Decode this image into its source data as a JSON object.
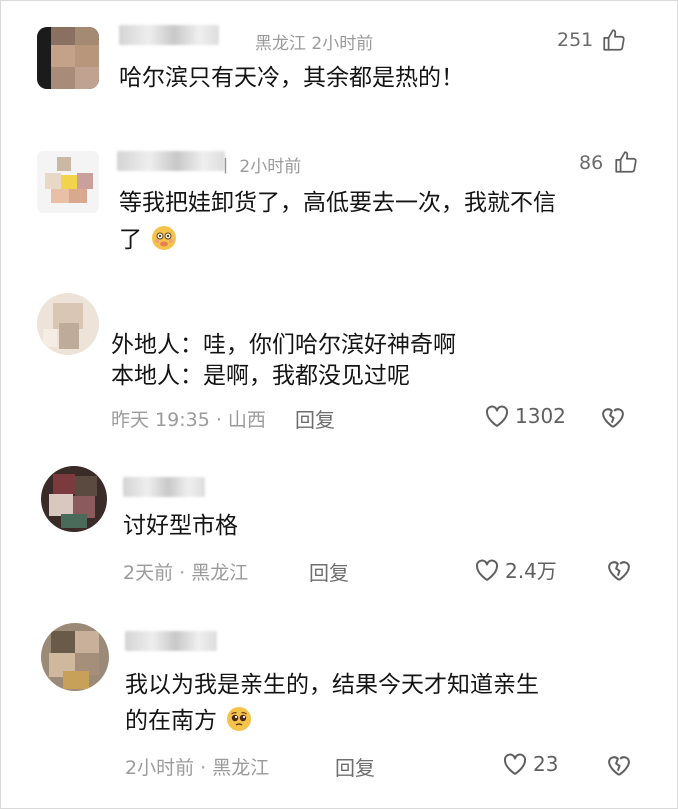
{
  "comments": [
    {
      "location_time": "黑龙江  2小时前",
      "likes": "251",
      "text_lines": [
        "哈尔滨只有天冷，其余都是热的！"
      ]
    },
    {
      "location_time": "丨 2小时前",
      "likes": "86",
      "text_lines": [
        "等我把娃卸货了，高低要去一次，我就不信",
        "了"
      ]
    },
    {
      "text_lines": [
        "外地人：哇，你们哈尔滨好神奇啊",
        "本地人：是啊，我都没见过呢"
      ],
      "footer": "昨天 19:35 · 山西",
      "reply": "回复",
      "likes": "1302"
    },
    {
      "text_lines": [
        "讨好型市格"
      ],
      "footer": "2天前 · 黑龙江",
      "reply": "回复",
      "likes": "2.4万"
    },
    {
      "text_lines": [
        "我以为我是亲生的，结果今天才知道亲生",
        "的在南方"
      ],
      "footer": "2小时前 · 黑龙江",
      "reply": "回复",
      "likes": "23"
    }
  ],
  "icons": {
    "like": "thumbs-up-icon",
    "heart": "heart-icon",
    "dislike": "broken-heart-icon",
    "emoji_2": "dizzy-face-emoji",
    "emoji_5": "pleading-face-emoji"
  },
  "colors": {
    "text": "#141414",
    "meta": "#9a9a9a",
    "icon": "#5f5f5f"
  }
}
